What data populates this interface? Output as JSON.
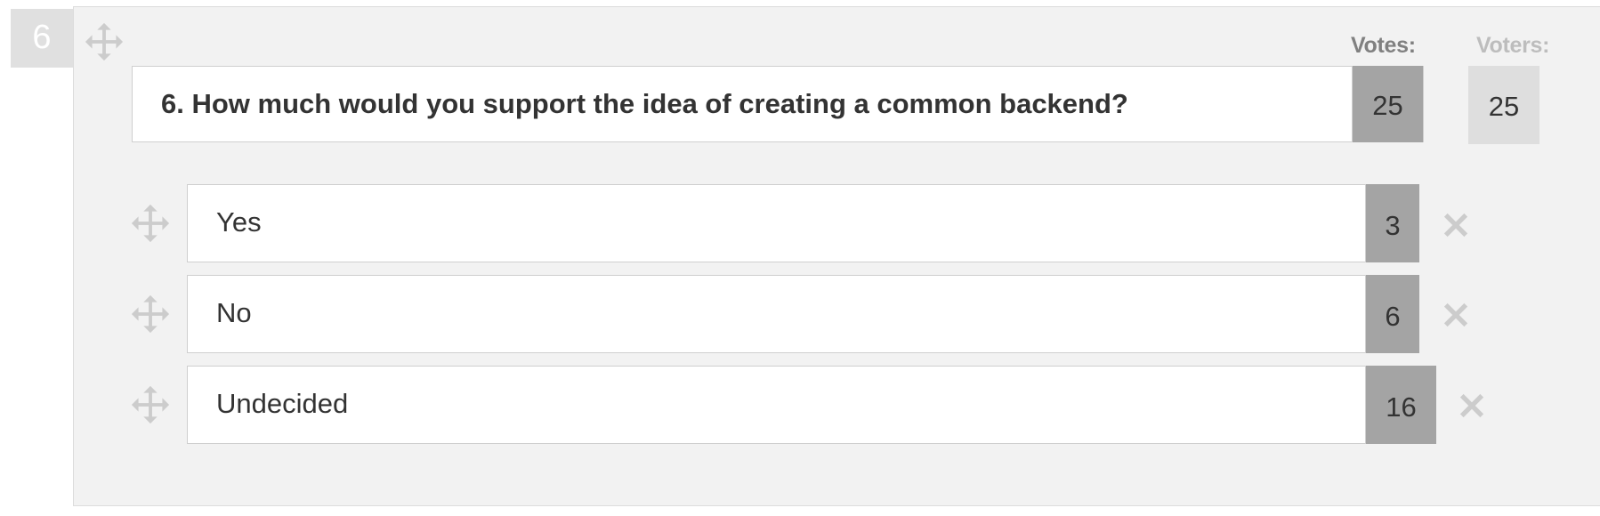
{
  "question": {
    "number": "6",
    "text": "6. How much would you support the idea of creating a common backend?",
    "votes": "25",
    "voters": "25"
  },
  "headers": {
    "votes_label": "Votes:",
    "voters_label": "Voters:"
  },
  "answers": [
    {
      "label": "Yes",
      "votes": "3"
    },
    {
      "label": "No",
      "votes": "6"
    },
    {
      "label": "Undecided",
      "votes": "16"
    }
  ],
  "icons": {
    "move": "move-icon",
    "delete": "close-icon"
  },
  "colors": {
    "panel_background": "#f2f2f2",
    "vote_count_background": "#a4a4a4",
    "voters_background": "#dedede",
    "icon_gray": "#cccccc"
  }
}
